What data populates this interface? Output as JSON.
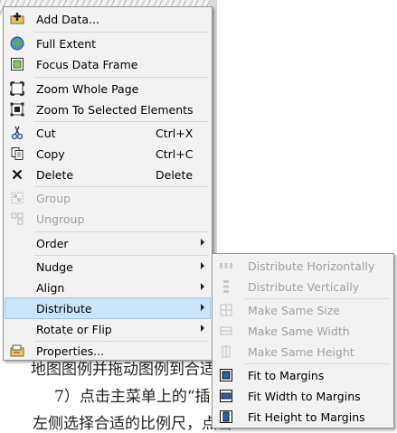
{
  "background": {
    "line1": "地图图例并拖动图例到合适位",
    "line2": "7）点击主菜单上的“插",
    "line3": "左侧选择合适的比例尺，点击"
  },
  "context_menu": {
    "items": [
      {
        "label": "Add Data...",
        "icon": "add-data-icon"
      },
      {
        "label": "Full Extent",
        "icon": "globe-icon"
      },
      {
        "label": "Focus Data Frame",
        "icon": "focus-frame-icon"
      },
      {
        "label": "Zoom Whole Page",
        "icon": "zoom-page-icon"
      },
      {
        "label": "Zoom To Selected Elements",
        "icon": "zoom-selected-icon"
      },
      {
        "label": "Cut",
        "shortcut": "Ctrl+X",
        "icon": "scissors-icon"
      },
      {
        "label": "Copy",
        "shortcut": "Ctrl+C",
        "icon": "copy-icon"
      },
      {
        "label": "Delete",
        "shortcut": "Delete",
        "icon": "delete-x-icon"
      },
      {
        "label": "Group",
        "icon": "group-icon",
        "disabled": true
      },
      {
        "label": "Ungroup",
        "icon": "ungroup-icon",
        "disabled": true
      },
      {
        "label": "Order",
        "submenu": true
      },
      {
        "label": "Nudge",
        "submenu": true
      },
      {
        "label": "Align",
        "submenu": true
      },
      {
        "label": "Distribute",
        "submenu": true,
        "highlighted": true
      },
      {
        "label": "Rotate or Flip",
        "submenu": true
      },
      {
        "label": "Properties...",
        "icon": "properties-icon"
      }
    ]
  },
  "distribute_submenu": {
    "items": [
      {
        "label": "Distribute Horizontally",
        "icon": "distribute-horizontal-icon",
        "disabled": true
      },
      {
        "label": "Distribute Vertically",
        "icon": "distribute-vertical-icon",
        "disabled": true
      },
      {
        "label": "Make Same Size",
        "icon": "same-size-icon",
        "disabled": true
      },
      {
        "label": "Make Same Width",
        "icon": "same-width-icon",
        "disabled": true
      },
      {
        "label": "Make Same Height",
        "icon": "same-height-icon",
        "disabled": true
      },
      {
        "label": "Fit to Margins",
        "icon": "fit-margins-icon"
      },
      {
        "label": "Fit Width to Margins",
        "icon": "fit-width-icon"
      },
      {
        "label": "Fit Height to Margins",
        "icon": "fit-height-icon"
      }
    ]
  },
  "colors": {
    "menu_bg": "#f2f2f2",
    "highlight": "#cce4f7",
    "disabled_text": "#a0a0a0"
  }
}
